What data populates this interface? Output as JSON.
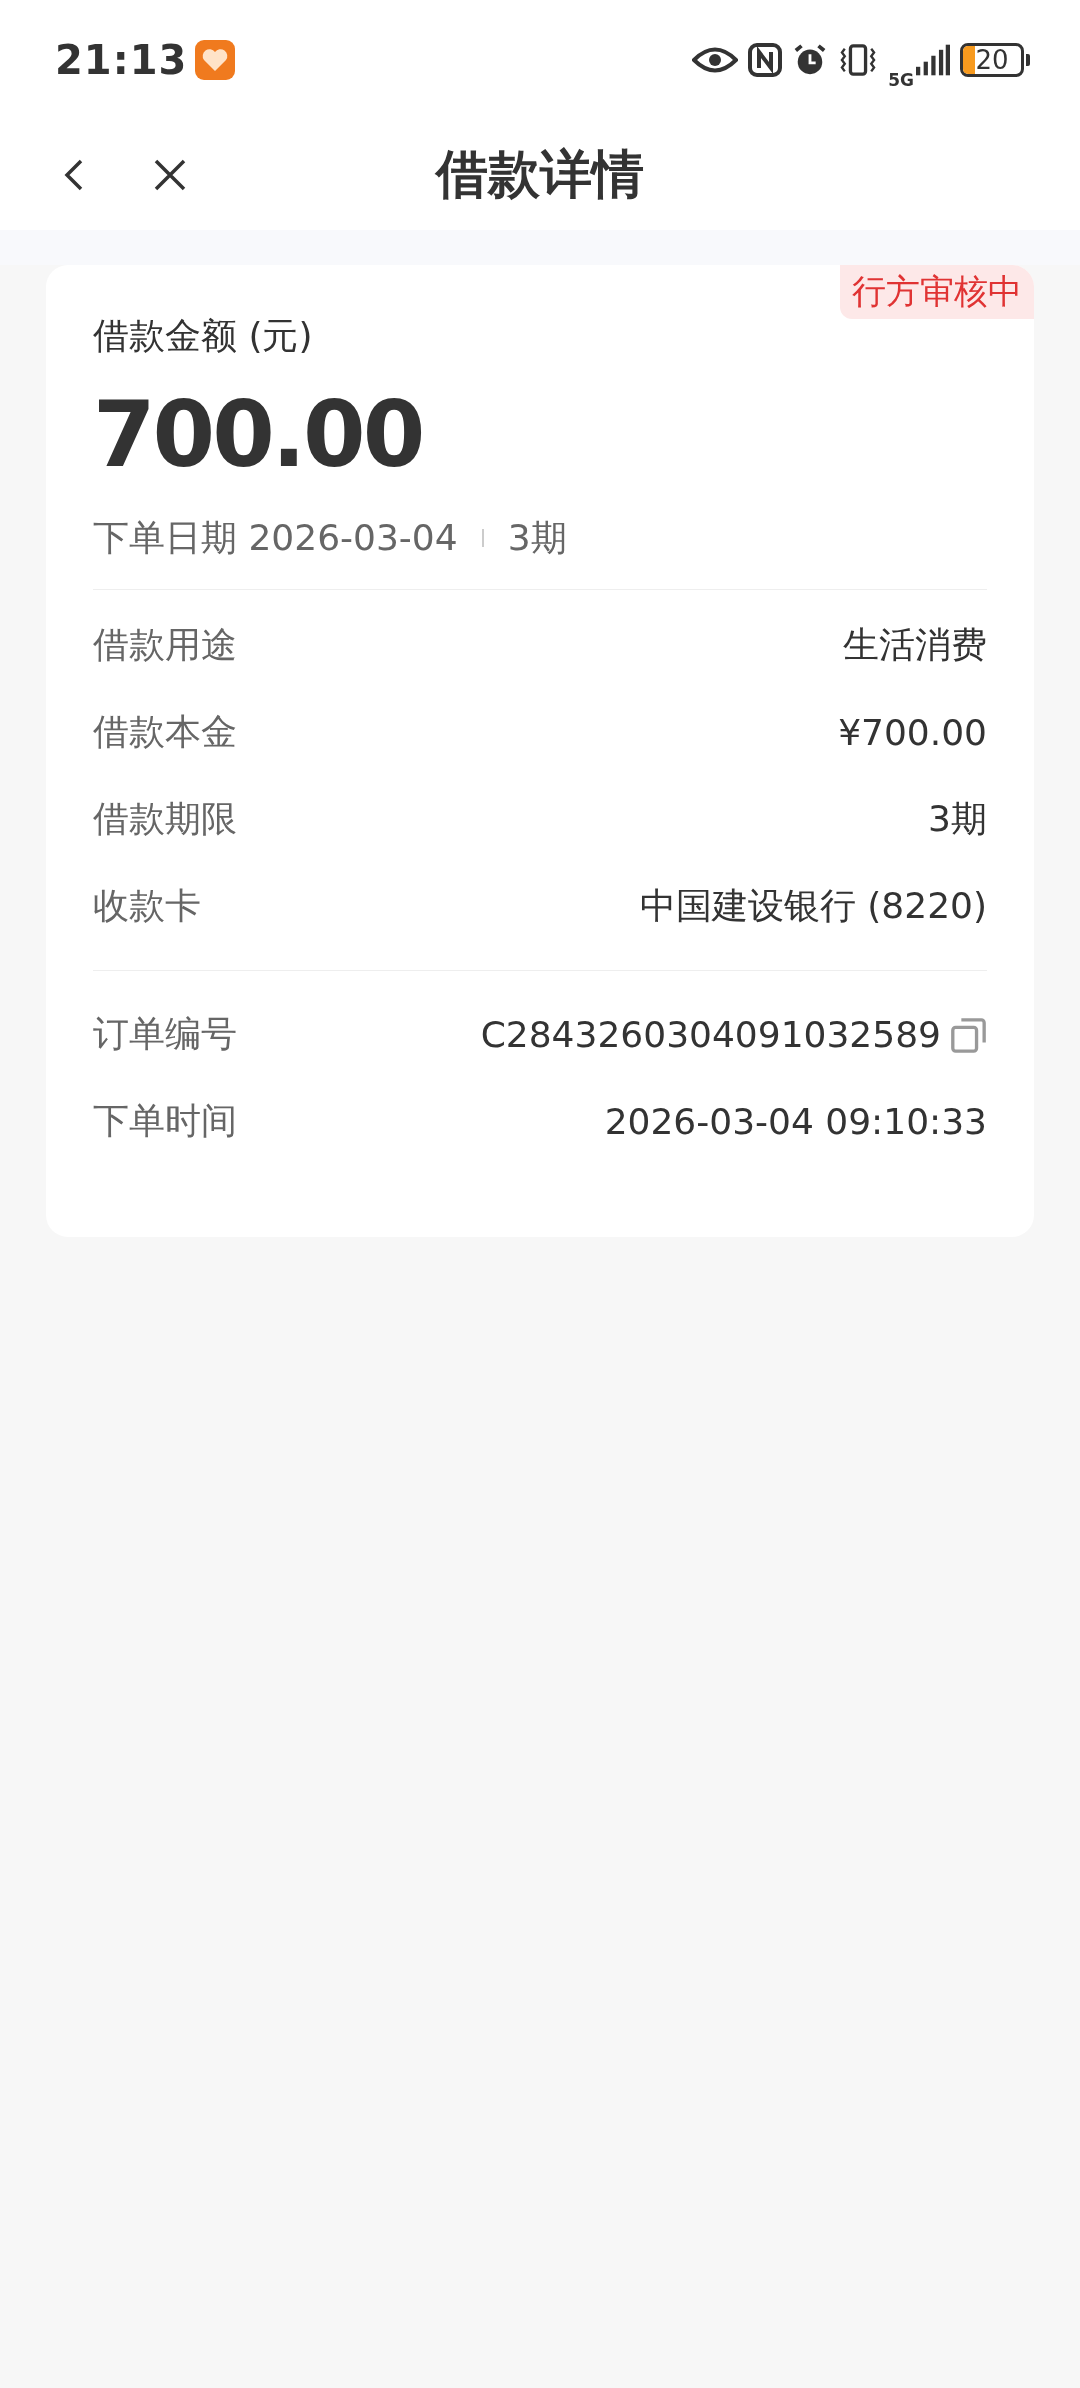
{
  "status_bar": {
    "time": "21:13",
    "network": "5G",
    "battery": "20"
  },
  "header": {
    "title": "借款详情"
  },
  "card": {
    "badge": "行方审核中",
    "amount_label": "借款金额 (元)",
    "amount": "700.00",
    "date": "下单日期 2026-03-04",
    "term": "3期",
    "details": [
      {
        "label": "借款用途",
        "value": "生活消费"
      },
      {
        "label": "借款本金",
        "value": "¥700.00"
      },
      {
        "label": "借款期限",
        "value": "3期"
      },
      {
        "label": "收款卡",
        "value": "中国建设银行 (8220)"
      }
    ],
    "order": [
      {
        "label": "订单编号",
        "value": "C2843260304091032589",
        "kind": "copyable"
      },
      {
        "label": "下单时间",
        "value": "2026-03-04 09:10:33",
        "kind": "plain"
      }
    ]
  }
}
